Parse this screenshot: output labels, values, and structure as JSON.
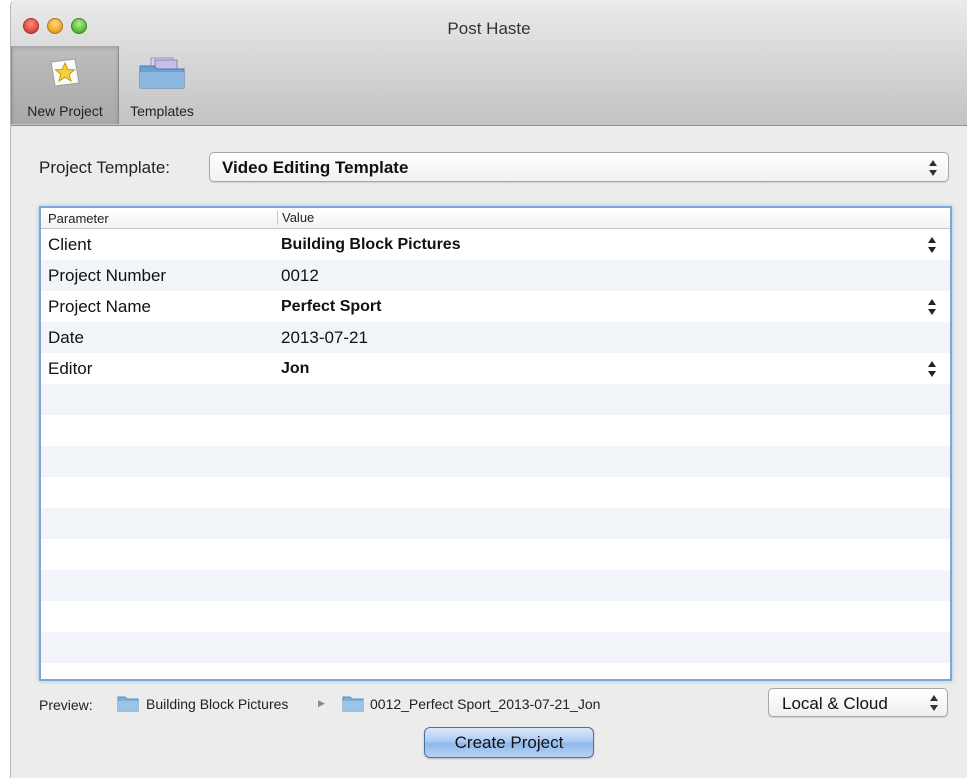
{
  "window": {
    "title": "Post Haste"
  },
  "toolbar": {
    "new_project_label": "New Project",
    "templates_label": "Templates"
  },
  "template_picker": {
    "label": "Project Template:",
    "selected": "Video Editing Template"
  },
  "params_table": {
    "columns": [
      "Parameter",
      "Value"
    ],
    "rows": [
      {
        "parameter": "Client",
        "value": "Building Block Pictures",
        "has_menu": true
      },
      {
        "parameter": "Project Number",
        "value": "0012",
        "has_menu": false
      },
      {
        "parameter": "Project Name",
        "value": "Perfect Sport",
        "has_menu": true
      },
      {
        "parameter": "Date",
        "value": "2013-07-21",
        "has_menu": false
      },
      {
        "parameter": "Editor",
        "value": "Jon",
        "has_menu": true
      }
    ]
  },
  "preview": {
    "label": "Preview:",
    "path": [
      "Building Block Pictures",
      "0012_Perfect Sport_2013-07-21_Jon"
    ]
  },
  "destination": {
    "selected": "Local & Cloud"
  },
  "actions": {
    "create_label": "Create Project"
  },
  "colors": {
    "focus_ring": "#7fa6d6",
    "alt_row": "#f1f5fa",
    "primary_button": "#a7c8f1"
  }
}
